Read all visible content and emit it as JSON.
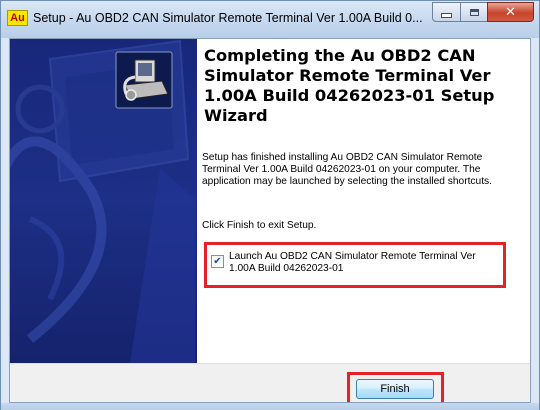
{
  "window": {
    "icon_text": "Au",
    "title": "Setup - Au OBD2 CAN Simulator Remote Terminal Ver 1.00A Build 0...",
    "controls": {
      "minimize_icon": "minimize-icon",
      "maximize_icon": "maximize-icon",
      "close_icon": "close-icon",
      "close_glyph": "✕"
    }
  },
  "wizard": {
    "heading": "Completing the Au OBD2 CAN Simulator Remote Terminal Ver 1.00A Build 04262023-01 Setup Wizard",
    "finished_text": "Setup has finished installing Au OBD2 CAN Simulator Remote Terminal Ver 1.00A Build 04262023-01 on your computer. The application may be launched by selecting the installed shortcuts.",
    "instruction": "Click Finish to exit Setup.",
    "launch_option": {
      "label": "Launch Au OBD2 CAN Simulator Remote Terminal Ver 1.00A Build 04262023-01",
      "checked": true,
      "check_glyph": "✔"
    },
    "side_icon": "installer-computer-icon"
  },
  "buttons": {
    "finish_label": "Finish"
  },
  "colors": {
    "highlight": "#e3222a",
    "side_panel": "#1d2f86",
    "title_bar": "#c5d8ee"
  }
}
